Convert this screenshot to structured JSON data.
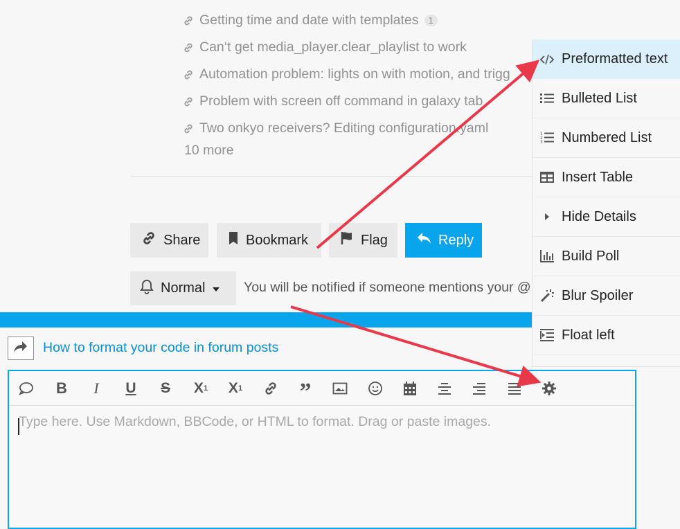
{
  "related_topics": [
    {
      "title": "Getting time and date with templates",
      "badge": "1"
    },
    {
      "title": "Can‘t get media_player.clear_playlist to work",
      "badge": ""
    },
    {
      "title": "Automation problem: lights on with motion, and trigg",
      "badge": ""
    },
    {
      "title": "Problem with screen off command in galaxy tab",
      "badge": ""
    },
    {
      "title": "Two onkyo receivers? Editing configuration.yaml",
      "badge": ""
    }
  ],
  "more_label": "10 more",
  "actions": {
    "share": "Share",
    "bookmark": "Bookmark",
    "flag": "Flag",
    "reply": "Reply"
  },
  "notification": {
    "level": "Normal",
    "description": "You will be notified if someone mentions your @name or replies to you."
  },
  "composer": {
    "reply_to_topic": "How to format your code in forum posts",
    "placeholder": "Type here. Use Markdown, BBCode, or HTML to format. Drag or paste images.",
    "toolbar": [
      "quote-icon",
      "bold-icon",
      "italic-icon",
      "underline-icon",
      "strikethrough-icon",
      "superscript-icon",
      "subscript-icon",
      "link-icon",
      "blockquote-icon",
      "image-icon",
      "emoji-icon",
      "calendar-icon",
      "align-center-icon",
      "align-right-icon",
      "justify-icon",
      "gear-icon"
    ]
  },
  "options_menu": [
    {
      "label": "Preformatted text",
      "icon": "code-icon",
      "active": true
    },
    {
      "label": "Bulleted List",
      "icon": "bullet-list-icon",
      "active": false
    },
    {
      "label": "Numbered List",
      "icon": "numbered-list-icon",
      "active": false
    },
    {
      "label": "Insert Table",
      "icon": "table-icon",
      "active": false
    },
    {
      "label": "Hide Details",
      "icon": "caret-right-icon",
      "active": false
    },
    {
      "label": "Build Poll",
      "icon": "poll-icon",
      "active": false
    },
    {
      "label": "Blur Spoiler",
      "icon": "magic-wand-icon",
      "active": false
    },
    {
      "label": "Float left",
      "icon": "indent-icon",
      "active": false
    }
  ],
  "colors": {
    "accent": "#08a5ec",
    "annotation_arrow": "#e8394a",
    "menu_highlight": "#dbf0fb"
  }
}
